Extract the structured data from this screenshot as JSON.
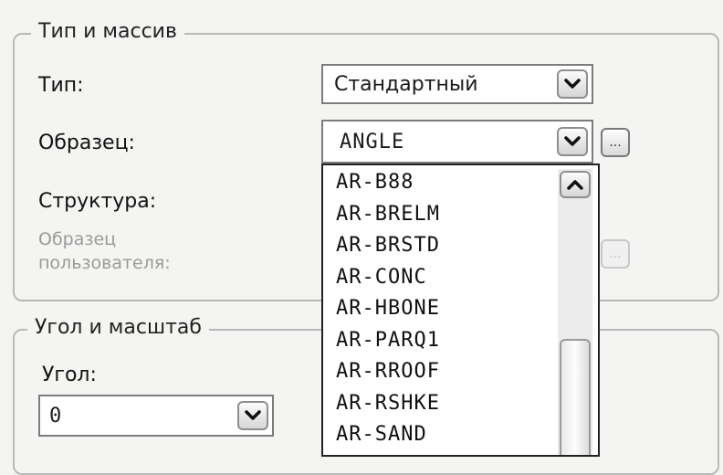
{
  "type_array": {
    "title": "Тип и массив",
    "type_label": "Тип:",
    "type_value": "Стандартный",
    "pattern_label": "Образец:",
    "pattern_value": "ANGLE",
    "structure_label": "Структура:",
    "user_pattern_label_line1": "Образец",
    "user_pattern_label_line2": "пользователя:",
    "ellipsis_label": "...",
    "user_pattern_ellipsis_label": "..."
  },
  "angle_scale": {
    "title": "Угол и масштаб",
    "angle_label": "Угол:",
    "angle_value": "0"
  },
  "pattern_dropdown": {
    "items": [
      "AR-B88",
      "AR-BRELM",
      "AR-BRSTD",
      "AR-CONC",
      "AR-HBONE",
      "AR-PARQ1",
      "AR-RROOF",
      "AR-RSHKE",
      "AR-SAND"
    ]
  },
  "icons": {
    "dropdown_arrow": "chevron-down-icon",
    "scroll_up": "chevron-up-icon"
  },
  "colors": {
    "background": "#f4f4f2",
    "group_border": "#b9b9b9",
    "disabled_text": "#9a9a9a"
  }
}
